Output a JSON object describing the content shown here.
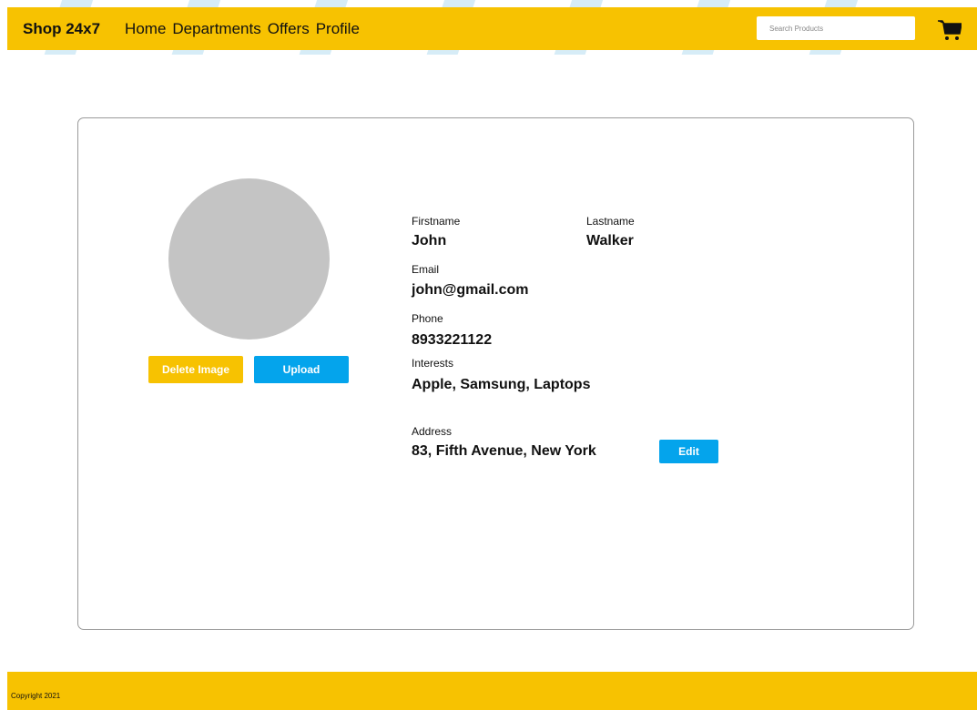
{
  "header": {
    "brand": "Shop 24x7",
    "nav": [
      "Home",
      "Departments",
      "Offers",
      "Profile"
    ],
    "search_placeholder": "Search Products",
    "cart_icon": "cart-icon",
    "accent_color": "#f7c201"
  },
  "profile": {
    "firstname_label": "Firstname",
    "firstname": "John",
    "lastname_label": "Lastname",
    "lastname": "Walker",
    "email_label": "Email",
    "email": "john@gmail.com",
    "phone_label": "Phone",
    "phone": "8933221122",
    "interests_label": "Interests",
    "interests": "Apple, Samsung, Laptops",
    "address_label": "Address",
    "address": "83, Fifth Avenue, New York"
  },
  "buttons": {
    "delete_image": "Delete Image",
    "upload": "Upload",
    "edit": "Edit",
    "primary_color": "#04a4ec"
  },
  "footer": {
    "copyright": "Copyright 2021"
  }
}
